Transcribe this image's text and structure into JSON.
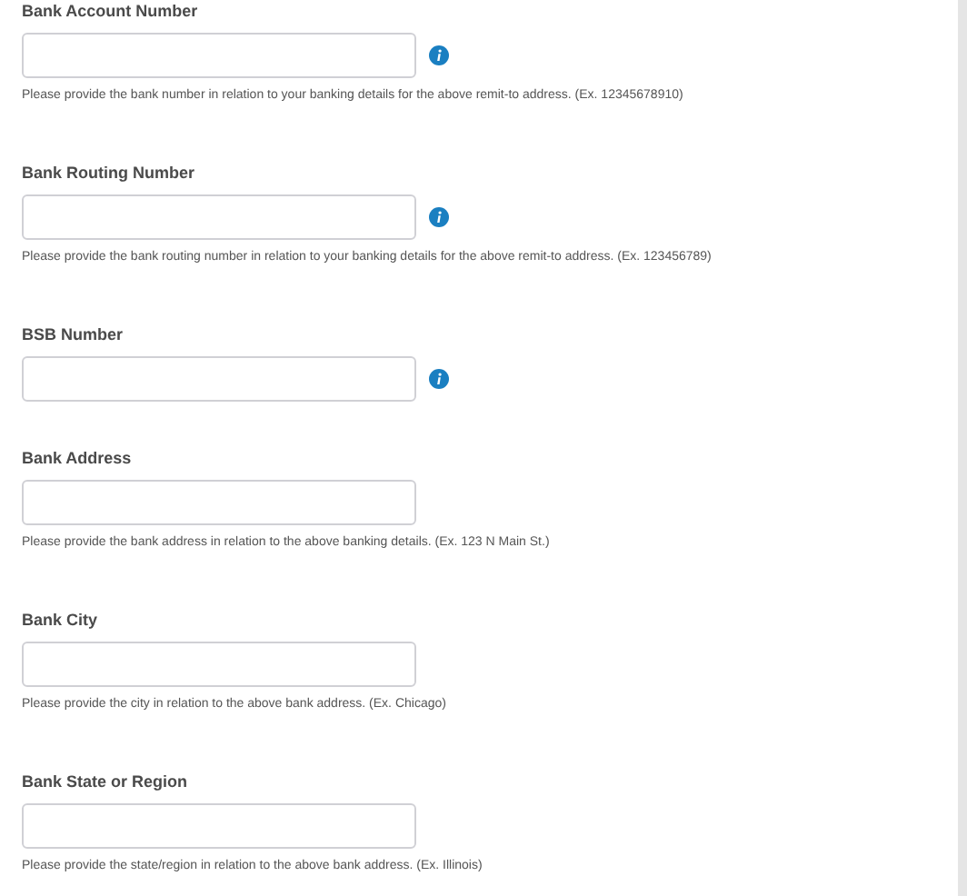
{
  "fields": [
    {
      "label": "Bank Account Number",
      "info": true,
      "help": "Please provide the bank number in relation to your banking details for the above remit-to address. (Ex. 12345678910)"
    },
    {
      "label": "Bank Routing Number",
      "info": true,
      "help": "Please provide the bank routing number in relation to your banking details for the above remit-to address. (Ex. 123456789)"
    },
    {
      "label": "BSB Number",
      "info": true
    },
    {
      "label": "Bank Address",
      "info": false,
      "help": "Please provide the bank address in relation to the above banking details. (Ex. 123 N Main St.)"
    },
    {
      "label": "Bank City",
      "info": false,
      "help": "Please provide the city in relation to the above bank address. (Ex. Chicago)"
    },
    {
      "label": "Bank State or Region",
      "info": false,
      "help": "Please provide the state/region in relation to the above bank address. (Ex. Illinois)"
    }
  ]
}
